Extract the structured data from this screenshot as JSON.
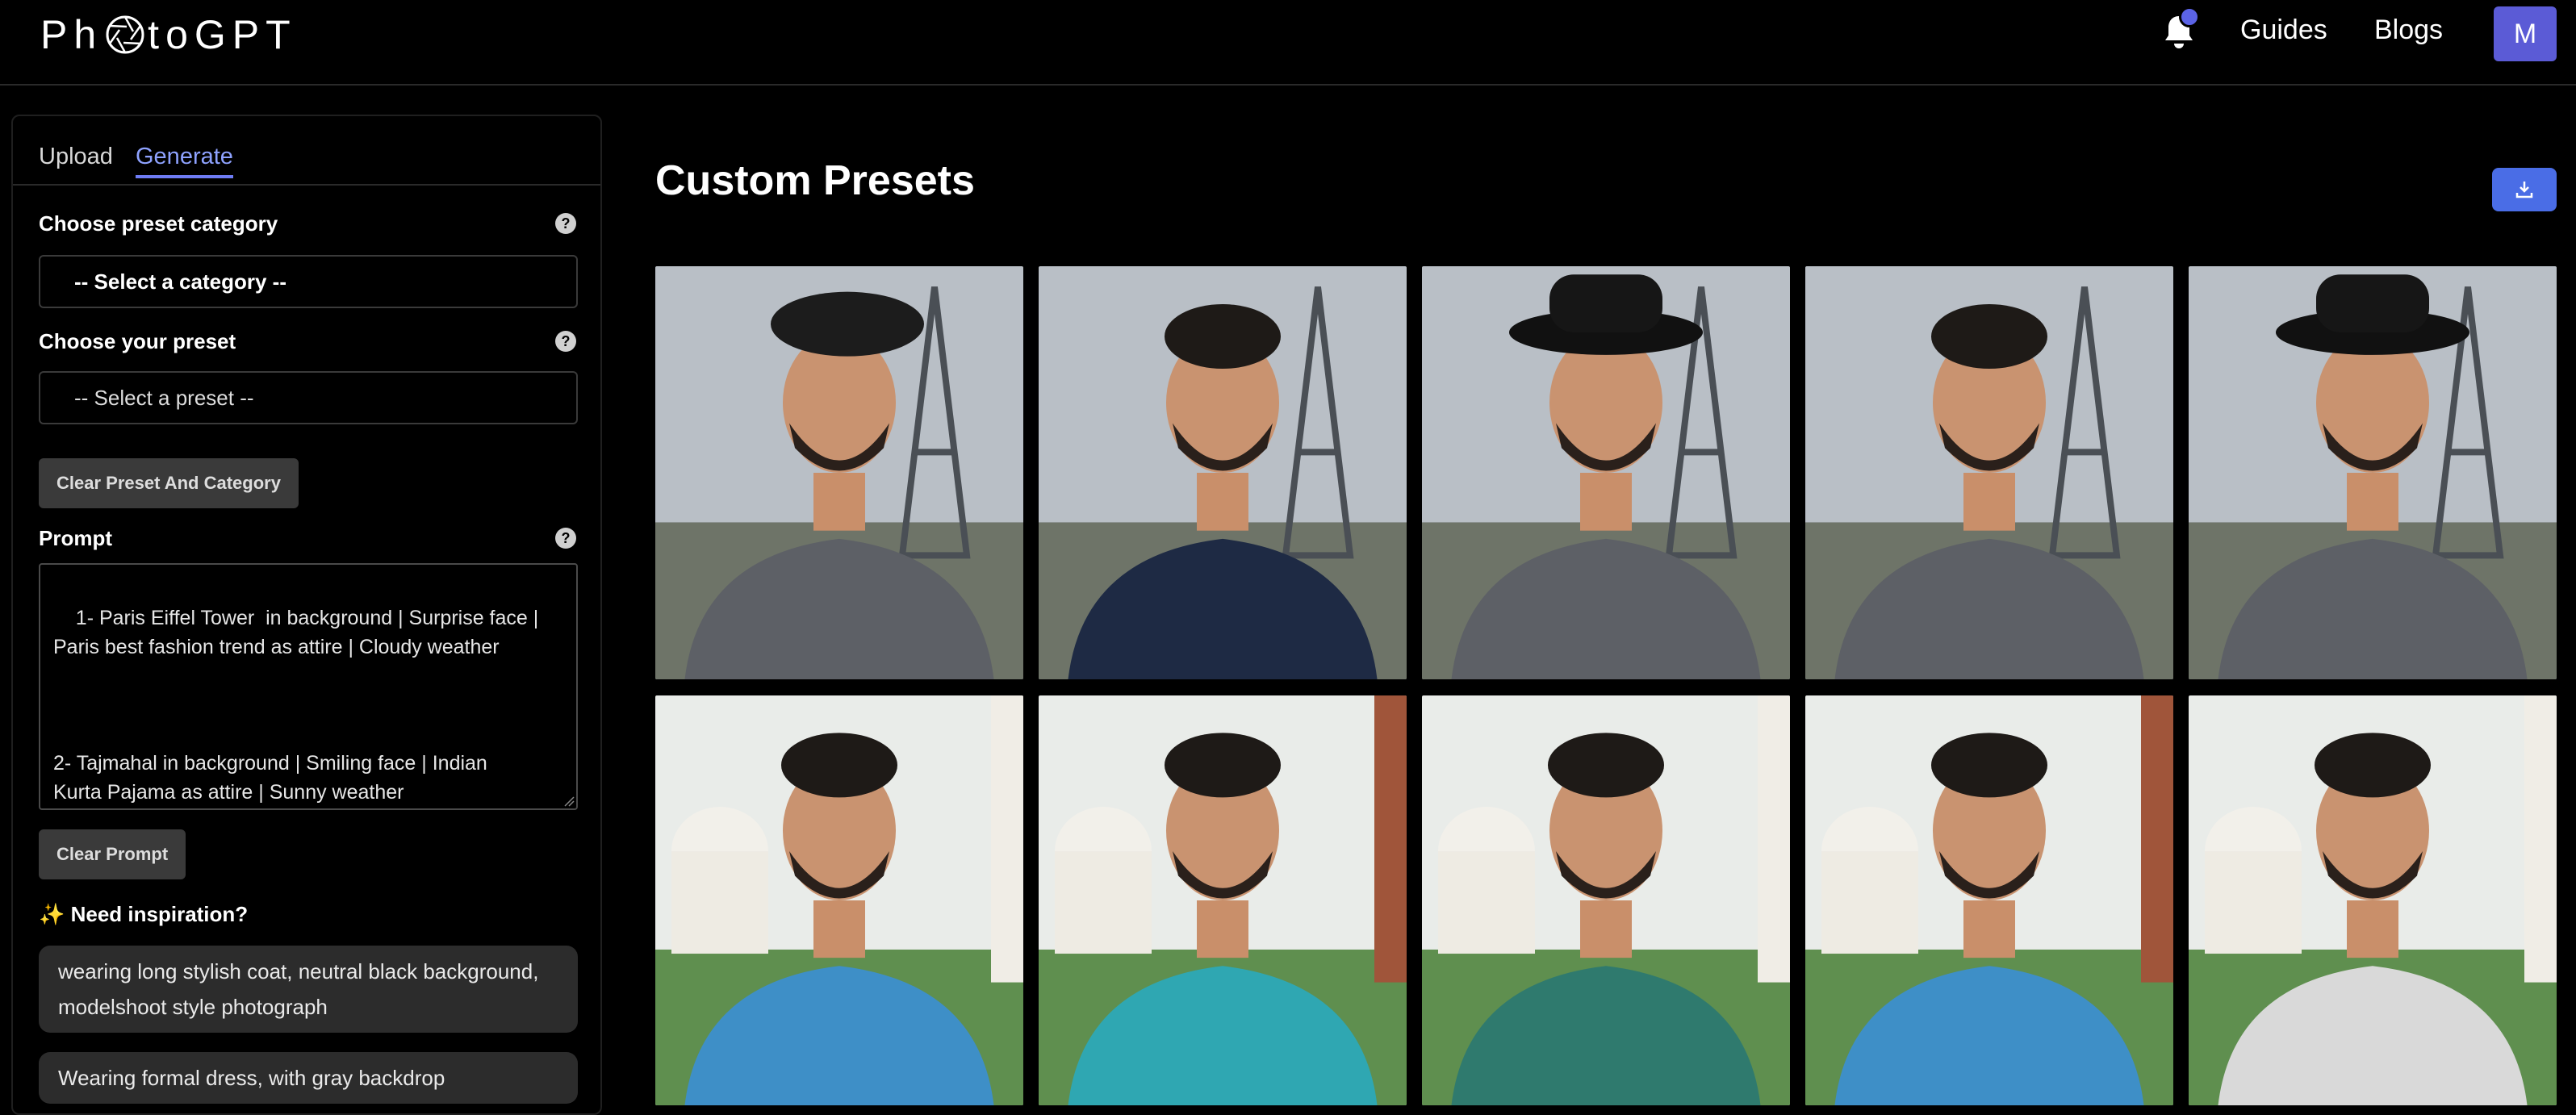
{
  "app": {
    "logo_prefix": "Ph",
    "logo_suffix": "toGPT"
  },
  "nav": {
    "guides": "Guides",
    "blogs": "Blogs",
    "avatar_initial": "M"
  },
  "sidebar": {
    "tabs": [
      {
        "label": "Upload"
      },
      {
        "label": "Generate"
      }
    ],
    "active_tab": "Generate",
    "category_label": "Choose preset category",
    "category_select": "-- Select a category --",
    "preset_label": "Choose your preset",
    "preset_select": "-- Select a preset --",
    "clear_preset_button": "Clear Preset And Category",
    "prompt_label": "Prompt",
    "prompt_value": "1- Paris Eiffel Tower  in background | Surprise face |\nParis best fashion trend as attire | Cloudy weather\n\n\n\n2- Tajmahal in background | Smiling face | Indian\nKurta Pajama as attire | Sunny weather",
    "clear_prompt_button": "Clear Prompt",
    "inspiration_heading": "✨ Need inspiration?",
    "inspiration_chips": [
      "wearing long stylish coat, neutral black background, modelshoot style photograph",
      "Wearing formal dress, with gray backdrop"
    ],
    "help_icon_glyph": "?"
  },
  "main": {
    "title": "Custom Presets",
    "gallery": [
      {
        "row": 1,
        "scene": "paris",
        "headwear": "beret",
        "attire": "gray-check-suit"
      },
      {
        "row": 1,
        "scene": "paris",
        "headwear": "none",
        "attire": "navy-tuxedo-bowtie"
      },
      {
        "row": 1,
        "scene": "paris",
        "headwear": "black-fedora",
        "attire": "gray-check-suit"
      },
      {
        "row": 1,
        "scene": "paris",
        "headwear": "none",
        "attire": "gray-check-suit"
      },
      {
        "row": 1,
        "scene": "paris",
        "headwear": "black-fedora",
        "attire": "gray-check-suit"
      },
      {
        "row": 2,
        "scene": "tajmahal",
        "headwear": "none",
        "attire": "blue-kurta"
      },
      {
        "row": 2,
        "scene": "tajmahal",
        "headwear": "none",
        "attire": "teal-kurta"
      },
      {
        "row": 2,
        "scene": "tajmahal",
        "headwear": "none",
        "attire": "green-kurta"
      },
      {
        "row": 2,
        "scene": "tajmahal",
        "headwear": "none",
        "attire": "blue-kurta"
      },
      {
        "row": 2,
        "scene": "tajmahal",
        "headwear": "none",
        "attire": "white-kurta"
      }
    ]
  },
  "colors": {
    "accent": "#6e7cf5",
    "avatar_bg": "#5b5bd6",
    "download_bg": "#4a6de6",
    "chip_bg": "#2c2c2c",
    "button_bg": "#3a3a3a"
  },
  "icons": {
    "bell": "bell-icon",
    "download": "download-icon",
    "help": "help-icon",
    "logo_mark": "aperture-icon"
  }
}
